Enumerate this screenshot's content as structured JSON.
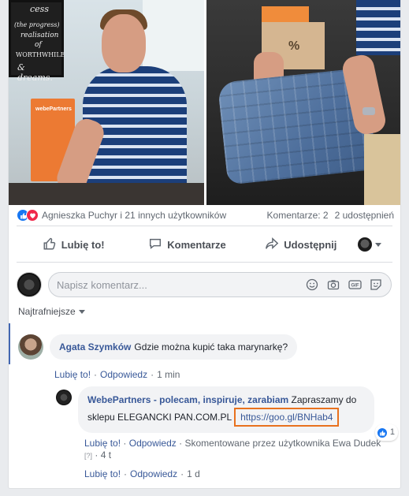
{
  "post": {
    "reactions": {
      "names": "Agnieszka Puchyr i 21 innych użytkowników",
      "comments": "Komentarze: 2",
      "shares": "2 udostępnień"
    },
    "actions": {
      "like": "Lubię to!",
      "comment": "Komentarze",
      "share": "Udostępnij"
    },
    "photo_text": {
      "chalk_line1": "cess",
      "chalk_line2": "(the progress)",
      "chalk_line3": "realisation",
      "chalk_line4": "of",
      "chalk_line5": "WORTHWHILE",
      "chalk_line6": "& dreams.",
      "panel_brand": "webePartners",
      "jacket_tag": "%"
    }
  },
  "composer": {
    "placeholder": "Napisz komentarz..."
  },
  "sort": {
    "label": "Najtrafniejsze"
  },
  "comments": [
    {
      "author": "Agata Szymków",
      "text": "Gdzie można kupić taka marynarkę?",
      "like": "Lubię to!",
      "reply": "Odpowiedz",
      "time": "1 min"
    }
  ],
  "reply": {
    "author": "WebePartners - polecam, inspiruje, zarabiam",
    "text": "Zapraszamy do sklepu ELEGANCKI PAN.COM.PL",
    "link": "https://goo.gl/BNHab4",
    "reaction_count": "1",
    "like": "Lubię to!",
    "reply": "Odpowiedz",
    "commented_by": "Skomentowane przez użytkownika Ewa Dudek",
    "qmark": "[?]",
    "time": "4 t"
  },
  "footer_meta": {
    "like": "Lubię to!",
    "reply": "Odpowiedz",
    "time": "1 d"
  },
  "colors": {
    "link": "#385898",
    "like_blue": "#1877f2",
    "love_red": "#f0284a",
    "highlight_orange": "#e8711e"
  }
}
